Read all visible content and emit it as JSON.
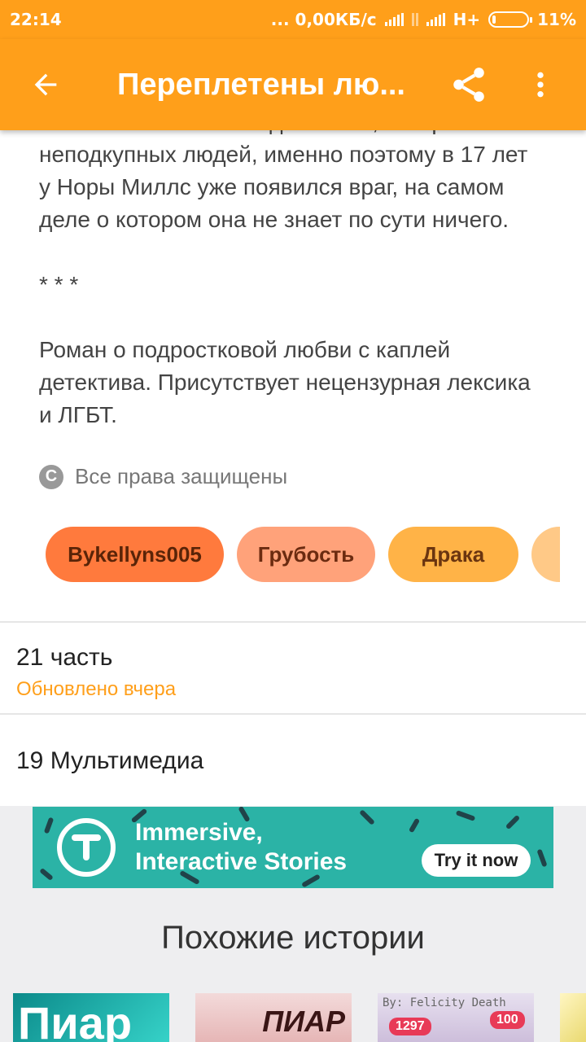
{
  "status_bar": {
    "time": "22:14",
    "network_speed": "... 0,00КБ/с",
    "network_type": "H+",
    "battery": "11%",
    "battery_level": 0.11
  },
  "app_bar": {
    "title": "Переплетены лю...",
    "back_icon": "arrow-back-icon",
    "share_icon": "share-icon",
    "more_icon": "more-vert-icon"
  },
  "description": {
    "lines_p1": [
      "Чтобы обезопасить в детей. Но, в мире мало",
      "неподкупных людей, именно поэтому в 17 лет",
      "у Норы Миллс уже появился враг, на самом",
      "деле о котором она не знает по сути ничего."
    ],
    "separator": "* * *",
    "lines_p2": [
      "Роман о подростковой любви с каплей",
      "детектива. Присутствует нецензурная лексика",
      "и ЛГБТ."
    ]
  },
  "copyright": {
    "icon": "copyright-icon",
    "text": "Все права защищены"
  },
  "tags": [
    "Bykellyns005",
    "Грубость",
    "Драка",
    ""
  ],
  "parts": {
    "count": "21 часть",
    "updated": "Обновлено вчера"
  },
  "media": {
    "count": "19 Мультимедиа"
  },
  "ad_banner": {
    "line1": "Immersive,",
    "line2": "Interactive Stories",
    "cta": "Try it now"
  },
  "similar": {
    "heading": "Похожие истории",
    "covers": [
      {
        "text": "Пиар"
      },
      {
        "text": "ПИАР"
      },
      {
        "by": "By: Felicity Death",
        "badge1": "1297",
        "badge2": "100"
      },
      {
        "text": ""
      }
    ]
  },
  "colors": {
    "accent": "#ff9f1a",
    "tag1": "#ff7a3d",
    "tag2": "#ffa27a",
    "tag3": "#ffb347",
    "banner": "#2bb3a6"
  }
}
